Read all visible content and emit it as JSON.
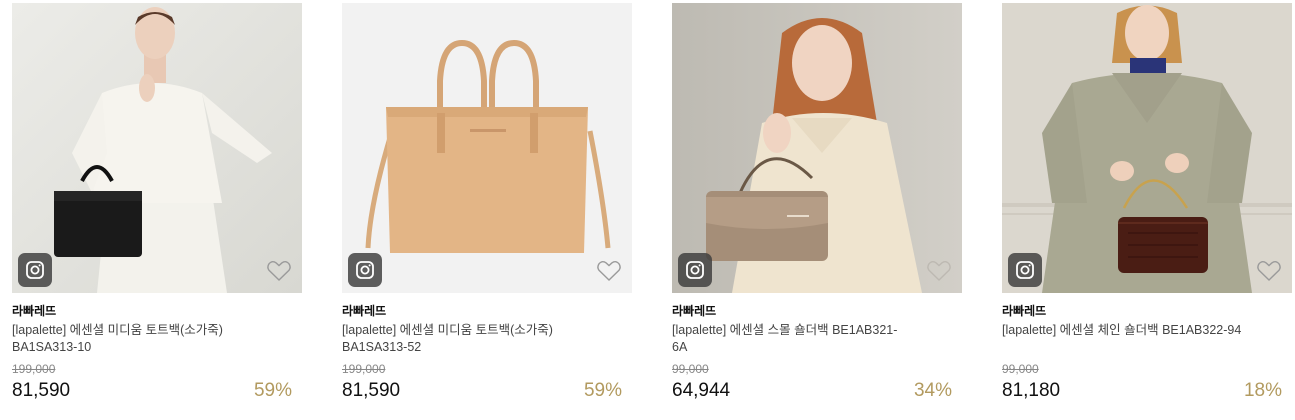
{
  "colors": {
    "discount": "#b29a5f",
    "price": "#111111",
    "original_price": "#888888",
    "insta_badge": "#3c3c3c"
  },
  "products": [
    {
      "image_alt": "model in white knit cardigan holding black tote bag",
      "brand": "라빠레뜨",
      "name": "[lapalette] 에센셜 미디움 토트백(소가죽) BA1SA313-10",
      "original_price": "199,000",
      "price": "81,590",
      "discount": "59%",
      "badge_icon": "instagram-icon",
      "wish_icon": "heart-outline-icon"
    },
    {
      "image_alt": "tan leather tote bag with shoulder strap",
      "brand": "라빠레뜨",
      "name": "[lapalette] 에센셜 미디움 토트백(소가죽) BA1SA313-52",
      "original_price": "199,000",
      "price": "81,590",
      "discount": "59%",
      "badge_icon": "instagram-icon",
      "wish_icon": "heart-outline-icon"
    },
    {
      "image_alt": "model in cream knit holding taupe shoulder bag",
      "brand": "라빠레뜨",
      "name": "[lapalette] 에센셜 스몰 숄더백 BE1AB321-6A",
      "original_price": "99,000",
      "price": "64,944",
      "discount": "34%",
      "badge_icon": "instagram-icon",
      "wish_icon": "heart-outline-icon"
    },
    {
      "image_alt": "model in trench coat holding brown croc chain bag",
      "brand": "라빠레뜨",
      "name": "[lapalette] 에센셜 체인 숄더백 BE1AB322-94",
      "original_price": "99,000",
      "price": "81,180",
      "discount": "18%",
      "badge_icon": "instagram-icon",
      "wish_icon": "heart-outline-icon"
    }
  ]
}
